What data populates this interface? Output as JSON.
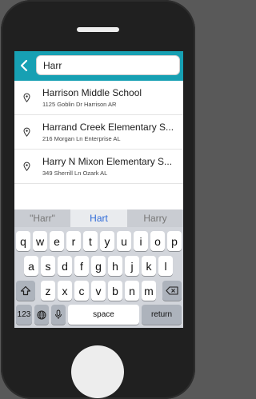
{
  "search": {
    "value": "Harr"
  },
  "results": [
    {
      "title": "Harrison Middle School",
      "address": "1125 Goblin Dr Harrison AR"
    },
    {
      "title": "Harrand Creek Elementary S...",
      "address": "216 Morgan Ln Enterprise AL"
    },
    {
      "title": "Harry N Mixon Elementary S...",
      "address": "349 Sherrill Ln Ozark AL"
    }
  ],
  "keyboard": {
    "suggestions": [
      "\"Harr\"",
      "Hart",
      "Harry"
    ],
    "row1": [
      "q",
      "w",
      "e",
      "r",
      "t",
      "y",
      "u",
      "i",
      "o",
      "p"
    ],
    "row2": [
      "a",
      "s",
      "d",
      "f",
      "g",
      "h",
      "j",
      "k",
      "l"
    ],
    "row3": [
      "z",
      "x",
      "c",
      "v",
      "b",
      "n",
      "m"
    ],
    "numbers_key": "123",
    "space_key": "space",
    "return_key": "return"
  },
  "colors": {
    "header": "#17a0b3",
    "phone_body": "#202020",
    "suggestion_highlight": "#2f6bd9"
  },
  "icons": [
    "back-arrow-icon",
    "location-pin-icon",
    "shift-icon",
    "delete-icon",
    "globe-icon",
    "microphone-icon"
  ]
}
